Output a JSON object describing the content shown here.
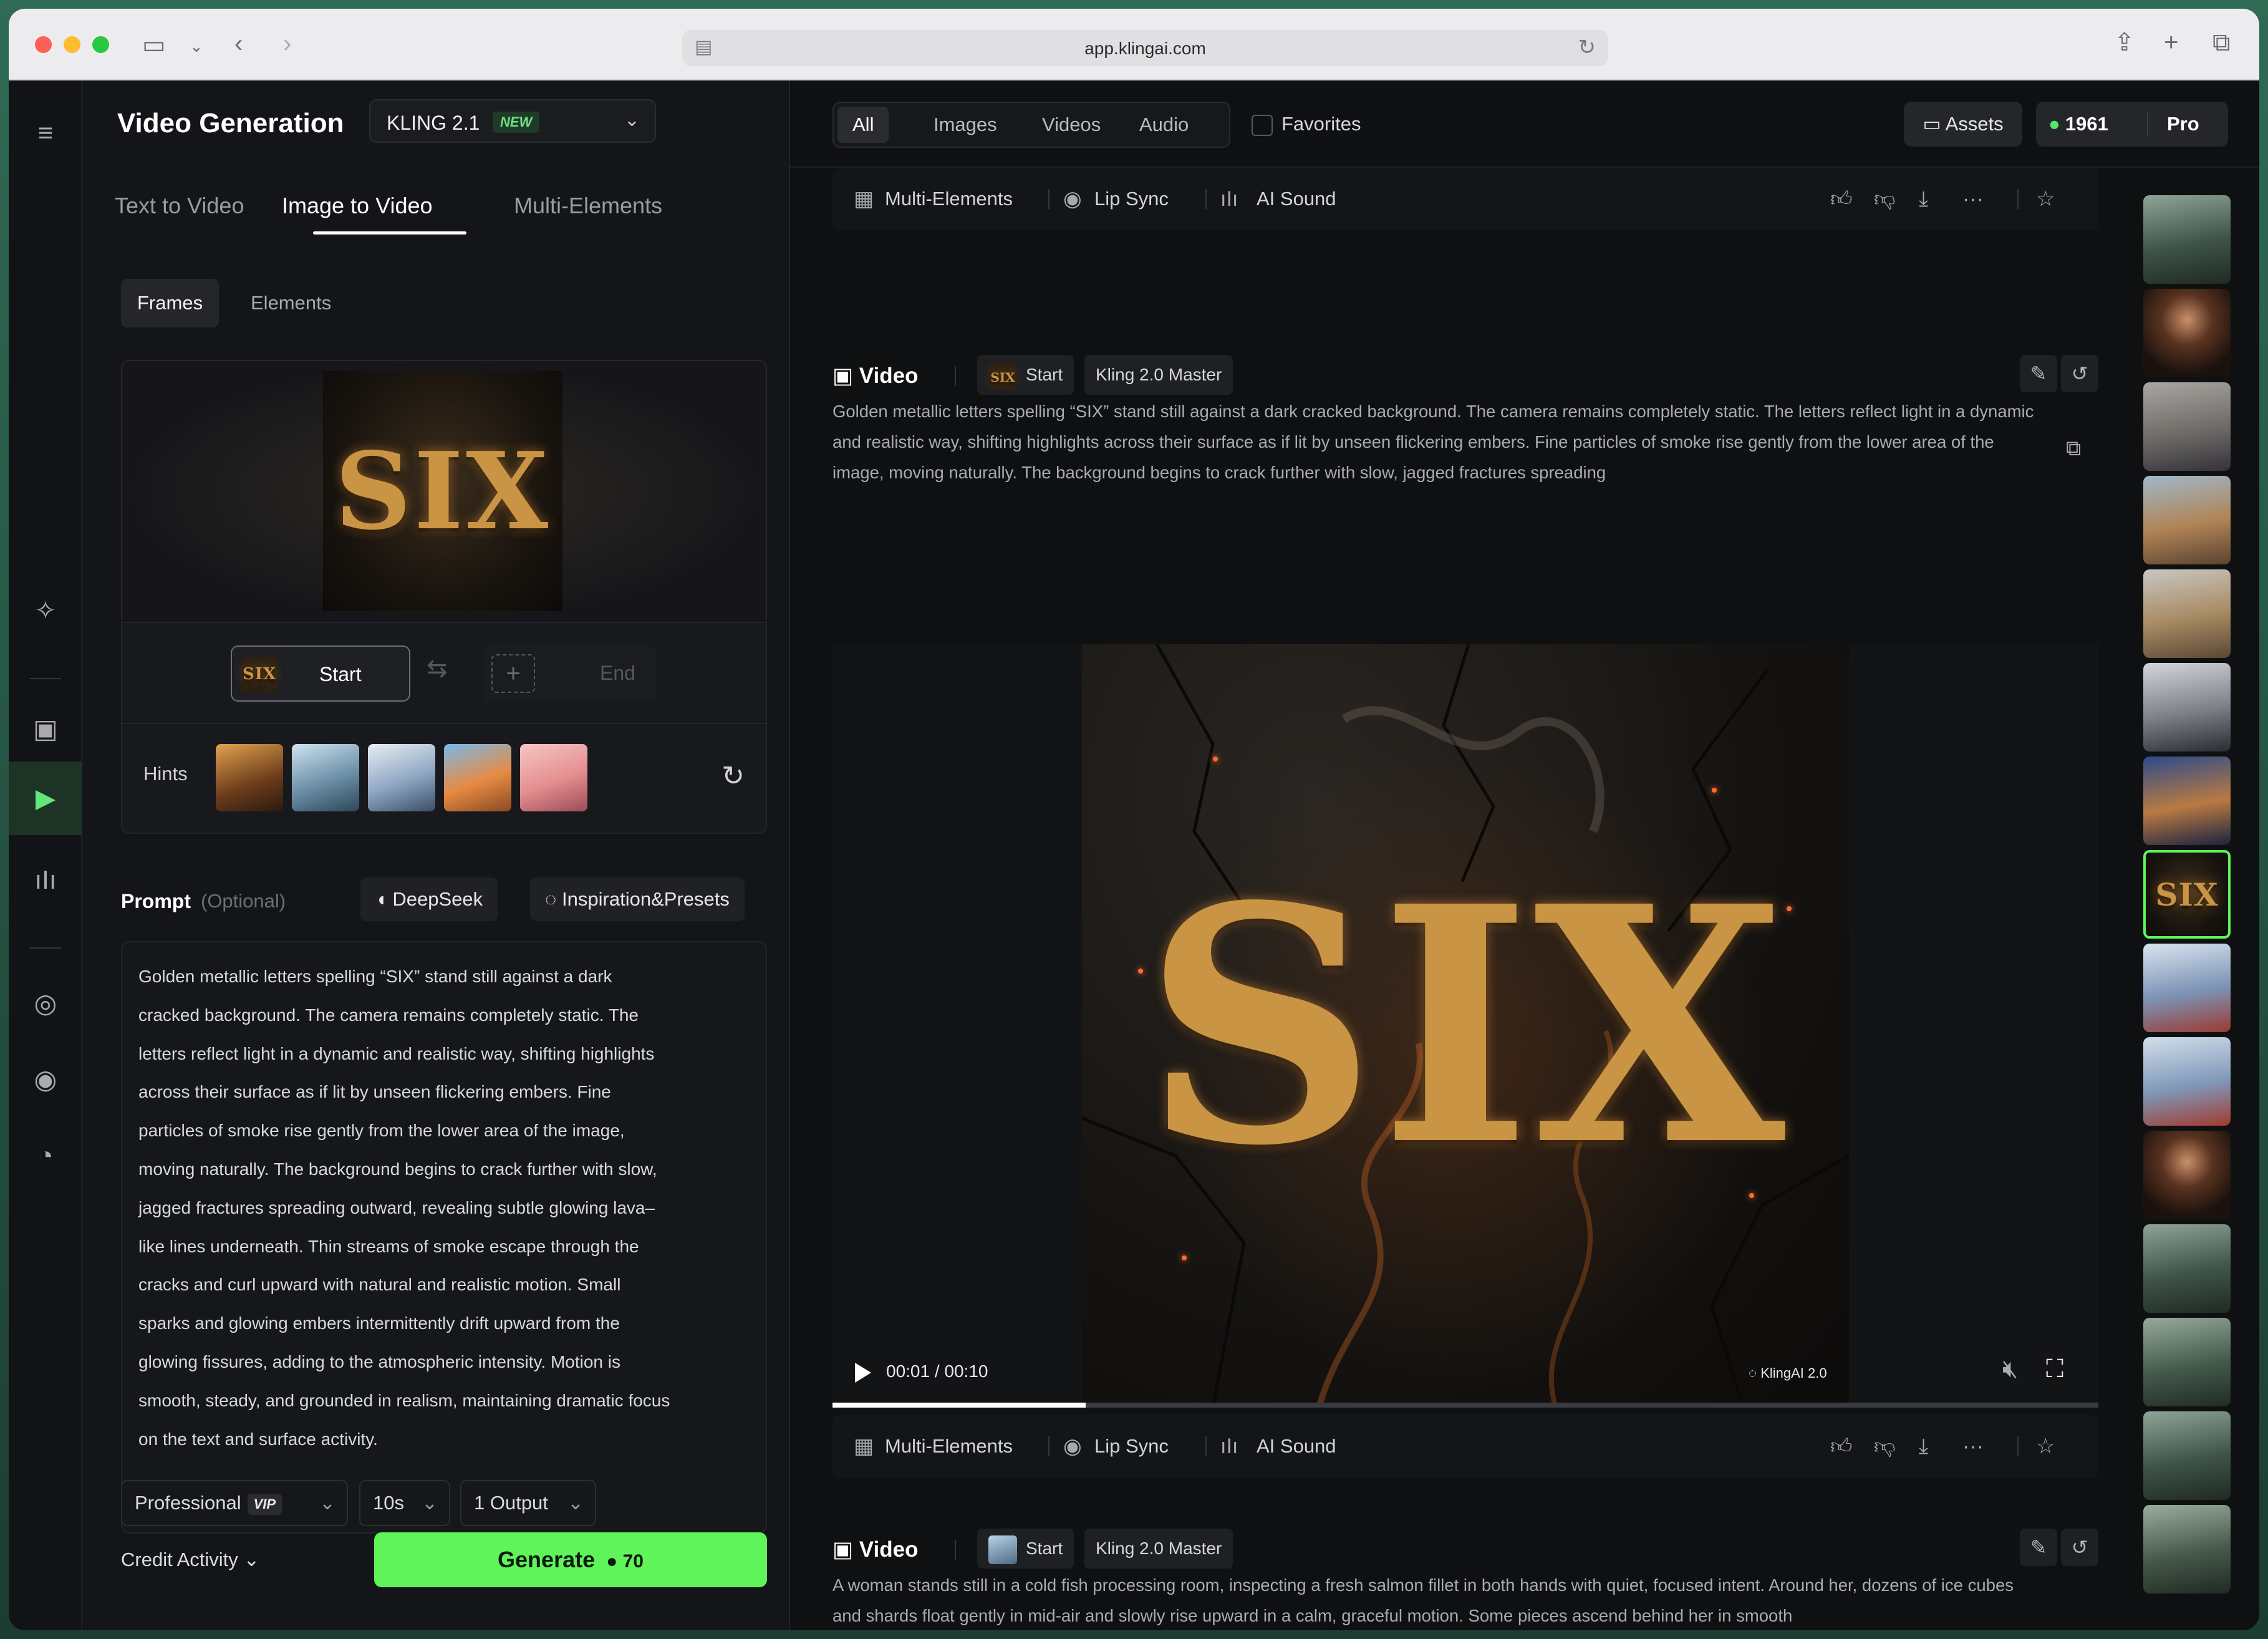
{
  "browser": {
    "url": "app.klingai.com"
  },
  "sidebar": {
    "title": "Video Generation",
    "model": {
      "name": "KLING 2.1",
      "badge": "NEW"
    },
    "mode_tabs": [
      "Text to Video",
      "Image to Video",
      "Multi-Elements"
    ],
    "active_mode": "Image to Video",
    "sub_tabs": [
      "Frames",
      "Elements"
    ],
    "frames": {
      "start_label": "Start",
      "end_label": "End",
      "start_thumb_text": "SIX",
      "preview_text": "SIX"
    },
    "hints_label": "Hints",
    "prompt": {
      "label": "Prompt",
      "optional": "(Optional)",
      "deepseek": "DeepSeek",
      "inspiration": "Inspiration&Presets",
      "text": "Golden metallic letters spelling “SIX” stand still against a dark\ncracked background. The camera remains completely static. The\nletters reflect light in a dynamic and realistic way, shifting highlights\nacross their surface as if lit by unseen flickering embers. Fine\nparticles of smoke rise gently from the lower area of the image,\nmoving naturally. The background begins to crack further with slow,\njagged fractures spreading outward, revealing subtle glowing lava–\nlike lines underneath. Thin streams of smoke escape through the\ncracks and curl upward with natural and realistic motion. Small\nsparks and glowing embers intermittently drift upward from the\nglowing fissures, adding to the atmospheric intensity. Motion is\nsmooth, steady, and grounded in realism, maintaining dramatic focus\non the text and surface activity."
    },
    "settings": {
      "quality": "Professional",
      "quality_badge": "VIP",
      "duration": "10s",
      "outputs": "1 Output"
    },
    "credit_activity": "Credit Activity",
    "generate": {
      "label": "Generate",
      "cost": "70"
    }
  },
  "topbar": {
    "filters": [
      "All",
      "Images",
      "Videos",
      "Audio"
    ],
    "active_filter": "All",
    "favorites": "Favorites",
    "assets": "Assets",
    "credits": "1961",
    "plan": "Pro"
  },
  "feed": {
    "actions": {
      "multi": "Multi-Elements",
      "lipsync": "Lip Sync",
      "sound": "AI Sound"
    },
    "items": [
      {
        "type_label": "Video",
        "start_label": "Start",
        "start_thumb_text": "SIX",
        "model": "Kling 2.0 Master",
        "description": "Golden metallic letters spelling “SIX” stand still against a dark cracked background. The camera remains completely static. The letters reflect light in a dynamic and realistic way, shifting highlights across their surface as if lit by unseen flickering embers. Fine particles of smoke rise gently from the lower area of the image, moving naturally. The background begins to crack further with slow, jagged fractures spreading",
        "player": {
          "title_text": "SIX",
          "time": "00:01 / 00:10",
          "watermark": "KlingAI 2.0",
          "progress": 0.2
        }
      },
      {
        "type_label": "Video",
        "start_label": "Start",
        "model": "Kling 2.0 Master",
        "description": "A woman stands still in a cold fish processing room, inspecting a fresh salmon fillet in both hands with quiet, focused intent. Around her, dozens of ice cubes and shards float gently in mid-air and slowly rise upward in a calm, graceful motion. Some pieces ascend behind her in smooth"
      }
    ]
  },
  "colors": {
    "accent": "#5ff45a",
    "gold": "#c99544",
    "background": "#0f1012"
  },
  "icons": {
    "menu": "menu-icon",
    "nav": [
      "rocket-icon",
      "image-icon",
      "video-icon",
      "audio-icon",
      "avatar-icon",
      "lipsync-icon",
      "history-icon"
    ]
  }
}
